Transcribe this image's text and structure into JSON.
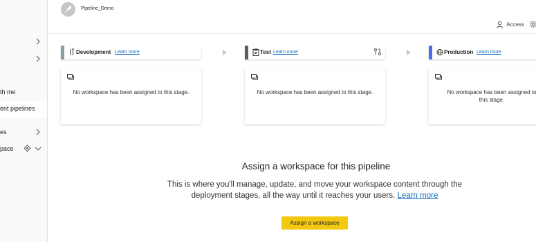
{
  "sidebar": {
    "items": [
      {
        "label": "",
        "has_chevron": true
      },
      {
        "label": "",
        "has_chevron": true
      },
      {
        "label": "th me"
      },
      {
        "label": "ent pipelines",
        "active": true
      },
      {
        "label": "es",
        "has_chevron": true
      },
      {
        "label": "pace",
        "has_chevron": true,
        "icon": "diamond-icon"
      }
    ]
  },
  "header": {
    "pipeline_name": "Pipeline_Demo",
    "access_label": "Access",
    "logo_icon": "rocket-icon",
    "settings_icon": "gear-icon"
  },
  "stages": [
    {
      "name": "Development",
      "learn_more": "Learn more",
      "color": "#8a9ca4",
      "icon": "tools-icon",
      "empty_message": "No workspace has been assigned to this stage."
    },
    {
      "name": "Test",
      "learn_more": "Learn more",
      "color": "#605e5c",
      "icon": "clipboard-icon",
      "extra_icon": "compare-icon",
      "empty_message": "No workspace has been assigned to this stage."
    },
    {
      "name": "Production",
      "learn_more": "Learn more",
      "color": "#4f6bed",
      "icon": "globe-icon",
      "empty_message": "No workspace has been assigned to this stage."
    }
  ],
  "empty_state": {
    "title": "Assign a workspace for this pipeline",
    "description": "This is where you'll manage, update, and move your workspace content through the deployment stages, all the way until it reaches your users.",
    "learn_more": "Learn more",
    "button_label": "Assign a workspace"
  },
  "colors": {
    "accent": "#f2c811",
    "link": "#0f6cbd"
  }
}
